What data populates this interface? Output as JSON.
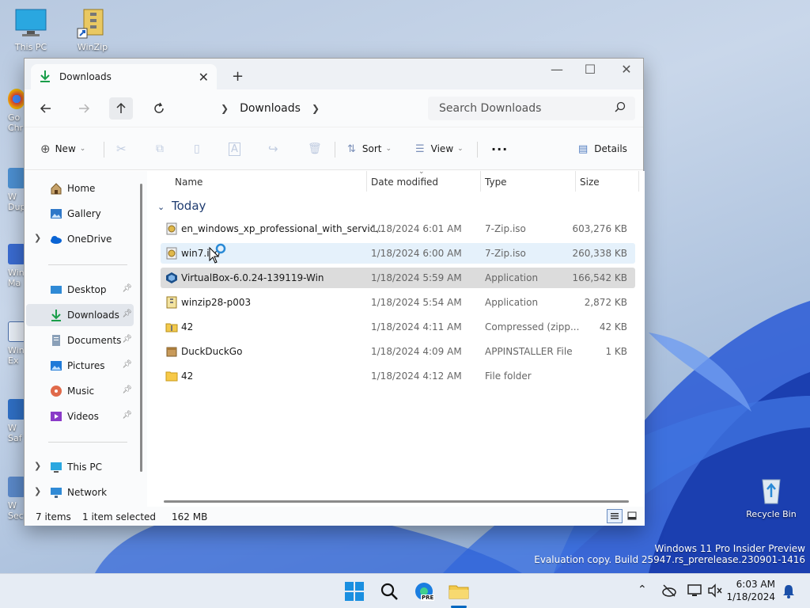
{
  "desktop": {
    "icons": [
      {
        "label": "This PC"
      },
      {
        "label": "WinZip"
      },
      {
        "label": "Recycle Bin"
      }
    ],
    "side_labels": [
      "Go\nChr",
      "W\nDupl",
      "WinZ\nMa",
      "Win\nEx",
      "W\nSaf",
      "W\nSecur..."
    ]
  },
  "window": {
    "tab_title": "Downloads",
    "nav": {
      "address_segment": "Downloads",
      "search_placeholder": "Search Downloads"
    },
    "toolbar": {
      "new_label": "New",
      "sort_label": "Sort",
      "view_label": "View",
      "more_label": "···",
      "details_label": "Details"
    },
    "sidebar": {
      "items": [
        {
          "label": "Home",
          "icon": "home-icon"
        },
        {
          "label": "Gallery",
          "icon": "gallery-icon"
        },
        {
          "label": "OneDrive",
          "icon": "cloud-icon"
        },
        {
          "label": "Desktop",
          "icon": "desktop-icon"
        },
        {
          "label": "Downloads",
          "icon": "download-icon"
        },
        {
          "label": "Documents",
          "icon": "document-icon"
        },
        {
          "label": "Pictures",
          "icon": "pictures-icon"
        },
        {
          "label": "Music",
          "icon": "music-icon"
        },
        {
          "label": "Videos",
          "icon": "videos-icon"
        },
        {
          "label": "This PC",
          "icon": "computer-icon"
        },
        {
          "label": "Network",
          "icon": "network-icon"
        }
      ]
    },
    "columns": {
      "name": "Name",
      "date": "Date modified",
      "type": "Type",
      "size": "Size"
    },
    "group_label": "Today",
    "files": [
      {
        "name": "en_windows_xp_professional_with_servic...",
        "date": "1/18/2024 6:01 AM",
        "type": "7-Zip.iso",
        "size": "603,276 KB",
        "icon": "iso-file-icon"
      },
      {
        "name": "win7.iso",
        "date": "1/18/2024 6:00 AM",
        "type": "7-Zip.iso",
        "size": "260,338 KB",
        "icon": "iso-file-icon"
      },
      {
        "name": "VirtualBox-6.0.24-139119-Win",
        "date": "1/18/2024 5:59 AM",
        "type": "Application",
        "size": "166,542 KB",
        "icon": "virtualbox-icon"
      },
      {
        "name": "winzip28-p003",
        "date": "1/18/2024 5:54 AM",
        "type": "Application",
        "size": "2,872 KB",
        "icon": "winzip-installer-icon"
      },
      {
        "name": "42",
        "date": "1/18/2024 4:11 AM",
        "type": "Compressed (zipp...",
        "size": "42 KB",
        "icon": "zip-folder-icon"
      },
      {
        "name": "DuckDuckGo",
        "date": "1/18/2024 4:09 AM",
        "type": "APPINSTALLER File",
        "size": "1 KB",
        "icon": "appinstaller-icon"
      },
      {
        "name": "42",
        "date": "1/18/2024 4:12 AM",
        "type": "File folder",
        "size": "",
        "icon": "folder-icon"
      }
    ],
    "status": {
      "count": "7 items",
      "selection": "1 item selected",
      "size": "162 MB"
    }
  },
  "taskbar": {
    "time": "6:03 AM",
    "date": "1/18/2024",
    "pre_badge": "PRE"
  },
  "watermark": {
    "line1": "Windows 11 Pro Insider Preview",
    "line2": "Evaluation copy. Build 25947.rs_prerelease.230901-1416"
  },
  "colors": {
    "accent": "#0067c0",
    "selection": "#dcdcdc",
    "hover": "#e5f1fb",
    "wallpaper_blue": "#1f4fc4"
  }
}
